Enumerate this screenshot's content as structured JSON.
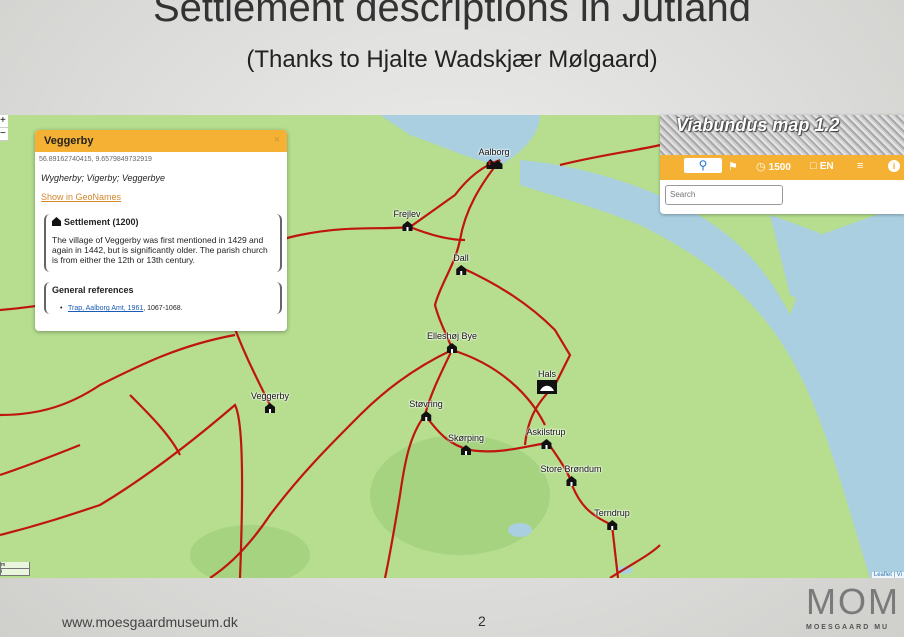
{
  "slide": {
    "title": "Settlement descriptions in Jutland",
    "subtitle": "(Thanks to Hjalte Wadskjær Mølgaard)",
    "url": "www.moesgaardmuseum.dk",
    "page_number": "2",
    "logo_mark": "MOM",
    "logo_text": "MOESGAARD MU"
  },
  "map": {
    "zoom_in": "+",
    "zoom_out": "−",
    "scale_top": "m",
    "scale_bottom": "i",
    "attribution": "Leaflet | Vi",
    "places": [
      {
        "name": "Aalborg",
        "icon": "town-icon"
      },
      {
        "name": "Frejlev",
        "icon": "house-icon"
      },
      {
        "name": "Dall",
        "icon": "house-icon"
      },
      {
        "name": "Elleshøj Bye",
        "icon": "house-icon"
      },
      {
        "name": "Veggerby",
        "icon": "house-icon"
      },
      {
        "name": "Støvring",
        "icon": "house-icon"
      },
      {
        "name": "Skørping",
        "icon": "house-icon"
      },
      {
        "name": "Hals",
        "icon": "ferry-icon"
      },
      {
        "name": "Askilstrup",
        "icon": "house-icon"
      },
      {
        "name": "Store Brøndum",
        "icon": "house-icon"
      },
      {
        "name": "Terndrup",
        "icon": "house-icon"
      }
    ]
  },
  "popup": {
    "title": "Veggerby",
    "close": "×",
    "coords": "56.89162740415, 9.6579849732919",
    "names": "Wygherby; Vigerby; Veggerbye",
    "link": "Show in GeoNames",
    "settlement_heading": "Settlement (1200)",
    "settlement_text": "The village of Veggerby was first mentioned in 1429 and again in 1442, but is significantly older. The parish church is from either the 12th or 13th century.",
    "references_heading": "General references",
    "reference_link": "Trap, Aalborg Amt, 1961",
    "reference_rest": ", 1067-1068."
  },
  "viabundus": {
    "title": "Viabundus map 1.2",
    "year": "1500",
    "language": "EN",
    "search_placeholder": "Search"
  },
  "colors": {
    "land": "#b6de8e",
    "water": "#a9cfe0",
    "road": "#c0150f",
    "accent": "#f4b133"
  }
}
